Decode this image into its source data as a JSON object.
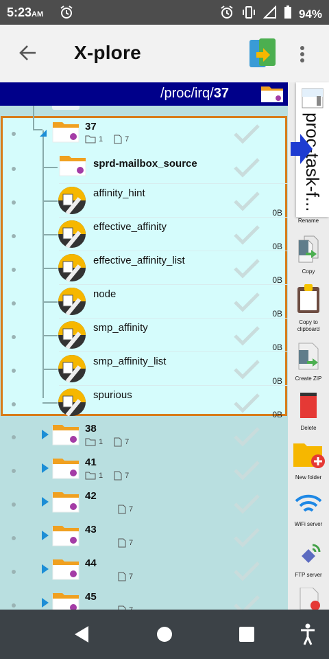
{
  "status": {
    "time": "5:23",
    "ampm": "AM",
    "battery": "94%"
  },
  "appbar": {
    "title": "X-plore"
  },
  "path": {
    "prefix": "/proc/irq/",
    "current": "37"
  },
  "folder37": {
    "name": "37",
    "dirs": "1",
    "files": "7"
  },
  "items": [
    {
      "name": "sprd-mailbox_source",
      "type": "folder",
      "size": ""
    },
    {
      "name": "affinity_hint",
      "type": "file",
      "size": "0B"
    },
    {
      "name": "effective_affinity",
      "type": "file",
      "size": "0B"
    },
    {
      "name": "effective_affinity_list",
      "type": "file",
      "size": "0B"
    },
    {
      "name": "node",
      "type": "file",
      "size": "0B"
    },
    {
      "name": "smp_affinity",
      "type": "file",
      "size": "0B"
    },
    {
      "name": "smp_affinity_list",
      "type": "file",
      "size": "0B"
    },
    {
      "name": "spurious",
      "type": "file",
      "size": "0B"
    }
  ],
  "folders": [
    {
      "name": "38",
      "dirs": "1",
      "files": "7"
    },
    {
      "name": "41",
      "dirs": "1",
      "files": "7"
    },
    {
      "name": "42",
      "dirs": "",
      "files": "7"
    },
    {
      "name": "43",
      "dirs": "",
      "files": "7"
    },
    {
      "name": "44",
      "dirs": "",
      "files": "7"
    },
    {
      "name": "45",
      "dirs": "",
      "files": "7"
    }
  ],
  "toolbar": {
    "task_text": "proc-task-f...",
    "rename": "Rename",
    "copy": "Copy",
    "copy_clipboard": "Copy to clipboard",
    "create_zip": "Create ZIP",
    "delete": "Delete",
    "new_folder": "New folder",
    "wifi_server": "WiFi server",
    "ftp_server": "FTP server"
  },
  "colors": {
    "selection_border": "#d87c1a",
    "selection_bg": "#d5fcfc",
    "pathbar_bg": "#00008a",
    "list_bg": "#b9dfe0"
  }
}
